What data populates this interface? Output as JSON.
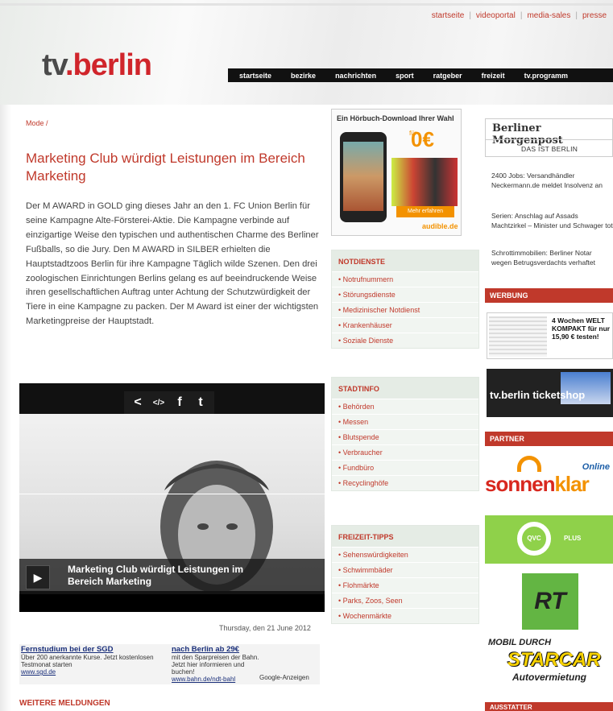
{
  "header": {
    "top_links": [
      "startseite",
      "videoportal",
      "media-sales",
      "presse"
    ],
    "logo": {
      "tv": "tv",
      "dot": ".",
      "berlin": "berlin"
    },
    "nav": [
      "startseite",
      "bezirke",
      "nachrichten",
      "sport",
      "ratgeber",
      "freizeit",
      "tv.programm"
    ]
  },
  "article": {
    "breadcrumb": "Mode /",
    "headline": "Marketing Club würdigt Leistungen im Bereich Marketing",
    "body": "Der M AWARD in GOLD ging dieses Jahr an den 1. FC Union Berlin für seine Kampagne Alte-Försterei-Aktie. Die Kampagne verbinde auf einzigartige Weise den typischen und authentischen Charme des Berliner Fußballs, so die Jury. Den M AWARD in SILBER erhielten die Hauptstadtzoos Berlin für ihre Kampagne Täglich wilde Szenen. Den drei zoologischen Einrichtungen Berlins gelang es auf beeindruckende Weise ihren gesellschaftlichen Auftrag unter Achtung der Schutzwürdigkeit der Tiere in eine Kampagne zu packen. Der M Award ist einer der wichtigsten Marketingpreise der Hauptstadt.",
    "video_title": "Marketing Club würdigt Leistungen im Bereich Marketing",
    "date": "Thursday, den 21 June 2012"
  },
  "text_ads": [
    {
      "title": "Fernstudium bei der SGD",
      "text": "Über 200 anerkannte Kurse. Jetzt kostenlosen Testmonat starten",
      "url": "www.sgd.de"
    },
    {
      "title": "nach Berlin ab 29€",
      "text": "mit den Sparpreisen der Bahn. Jetzt hier informieren und buchen!",
      "url": "www.bahn.de/ndt-bahl"
    }
  ],
  "google_ads": "Google-Anzeigen",
  "weitere": "WEITERE MELDUNGEN",
  "promo": {
    "title": "Ein Hörbuch-Download Ihrer Wahl",
    "fuer": "für",
    "price": "0€",
    "button": "Mehr erfahren",
    "brand": "audible.de"
  },
  "notdienste": {
    "title": "NOTDIENSTE",
    "items": [
      "Notrufnummern",
      "Störungsdienste",
      "Medizinischer Notdienst",
      "Krankenhäuser",
      "Soziale Dienste"
    ]
  },
  "stadtinfo": {
    "title": "STADTINFO",
    "items": [
      "Behörden",
      "Messen",
      "Blutspende",
      "Verbraucher",
      "Fundbüro",
      "Recyclinghöfe"
    ]
  },
  "freizeit": {
    "title": "FREIZEIT-TIPPS",
    "items": [
      "Sehenswürdigkeiten",
      "Schwimmbäder",
      "Flohmärkte",
      "Parks, Zoos, Seen",
      "Wochenmärkte"
    ]
  },
  "mopo": {
    "name": "Berliner Morgenpost",
    "sub": "DAS IST BERLIN",
    "news": [
      "2400 Jobs: Versandhändler Neckermann.de meldet Insolvenz an",
      "Serien: Anschlag auf Assads Machtzirkel – Minister und Schwager tot",
      "Schrottimmobilien: Berliner Notar wegen Betrugsverdachts verhaftet"
    ]
  },
  "werbung": "WERBUNG",
  "welt": {
    "text": "4 Wochen WELT KOMPAKT für nur 15,90 € testen!"
  },
  "ticketshop": "tv.berlin ticketshop",
  "partner": "PARTNER",
  "sonnenklar": {
    "a": "sonnen",
    "b": "klar",
    "online": "Online"
  },
  "qvc": {
    "logo": "QVC",
    "plus": "PLUS"
  },
  "rt": "RT",
  "starcar": {
    "mobil": "MOBIL DURCH",
    "name": "STARCAR",
    "sub": "Autovermietung"
  },
  "ausstatter": "AUSSTATTER"
}
